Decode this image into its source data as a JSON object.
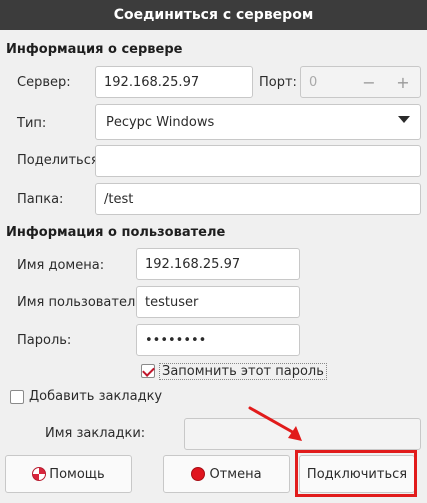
{
  "window": {
    "title": "Соединиться с сервером"
  },
  "server_info": {
    "heading": "Информация о сервере",
    "server_label": "Сервер:",
    "server_value": "192.168.25.97",
    "port_label": "Порт:",
    "port_value": "0",
    "port_minus": "−",
    "port_plus": "+",
    "type_label": "Тип:",
    "type_value": "Ресурс Windows",
    "share_label": "Поделиться:",
    "share_value": "",
    "folder_label": "Папка:",
    "folder_value": "/test"
  },
  "user_info": {
    "heading": "Информация о пользователе",
    "domain_label": "Имя домена:",
    "domain_value": "192.168.25.97",
    "username_label": "Имя пользователя:",
    "username_value": "testuser",
    "password_label": "Пароль:",
    "password_value": "••••••••",
    "remember_label": "Запомнить этот пароль",
    "remember_checked": true
  },
  "bookmark": {
    "add_label": "Добавить закладку",
    "add_checked": false,
    "name_label": "Имя закладки:",
    "name_value": ""
  },
  "buttons": {
    "help": "Помощь",
    "cancel": "Отмена",
    "connect": "Подключиться"
  },
  "annotation_color": "#e11b1b"
}
